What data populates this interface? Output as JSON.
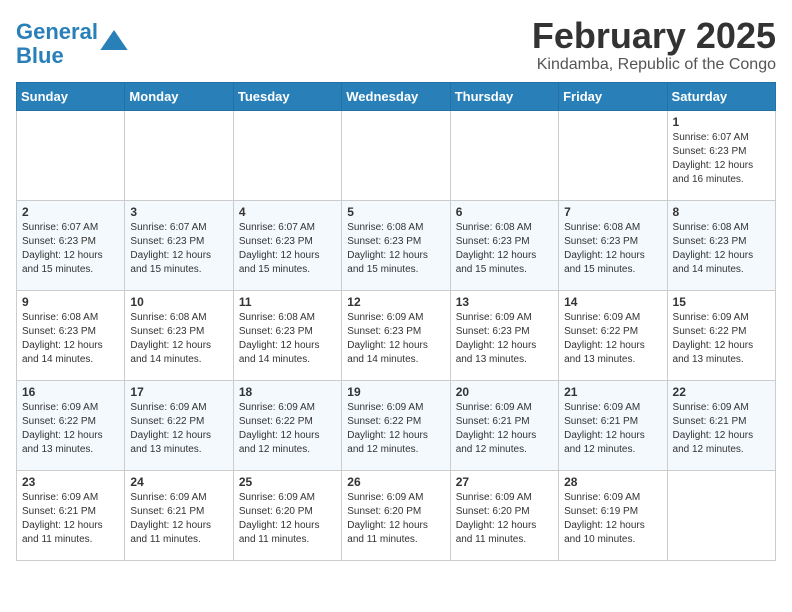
{
  "header": {
    "logo_line1": "General",
    "logo_line2": "Blue",
    "main_title": "February 2025",
    "subtitle": "Kindamba, Republic of the Congo"
  },
  "weekdays": [
    "Sunday",
    "Monday",
    "Tuesday",
    "Wednesday",
    "Thursday",
    "Friday",
    "Saturday"
  ],
  "weeks": [
    [
      {
        "day": "",
        "info": ""
      },
      {
        "day": "",
        "info": ""
      },
      {
        "day": "",
        "info": ""
      },
      {
        "day": "",
        "info": ""
      },
      {
        "day": "",
        "info": ""
      },
      {
        "day": "",
        "info": ""
      },
      {
        "day": "1",
        "info": "Sunrise: 6:07 AM\nSunset: 6:23 PM\nDaylight: 12 hours\nand 16 minutes."
      }
    ],
    [
      {
        "day": "2",
        "info": "Sunrise: 6:07 AM\nSunset: 6:23 PM\nDaylight: 12 hours\nand 15 minutes."
      },
      {
        "day": "3",
        "info": "Sunrise: 6:07 AM\nSunset: 6:23 PM\nDaylight: 12 hours\nand 15 minutes."
      },
      {
        "day": "4",
        "info": "Sunrise: 6:07 AM\nSunset: 6:23 PM\nDaylight: 12 hours\nand 15 minutes."
      },
      {
        "day": "5",
        "info": "Sunrise: 6:08 AM\nSunset: 6:23 PM\nDaylight: 12 hours\nand 15 minutes."
      },
      {
        "day": "6",
        "info": "Sunrise: 6:08 AM\nSunset: 6:23 PM\nDaylight: 12 hours\nand 15 minutes."
      },
      {
        "day": "7",
        "info": "Sunrise: 6:08 AM\nSunset: 6:23 PM\nDaylight: 12 hours\nand 15 minutes."
      },
      {
        "day": "8",
        "info": "Sunrise: 6:08 AM\nSunset: 6:23 PM\nDaylight: 12 hours\nand 14 minutes."
      }
    ],
    [
      {
        "day": "9",
        "info": "Sunrise: 6:08 AM\nSunset: 6:23 PM\nDaylight: 12 hours\nand 14 minutes."
      },
      {
        "day": "10",
        "info": "Sunrise: 6:08 AM\nSunset: 6:23 PM\nDaylight: 12 hours\nand 14 minutes."
      },
      {
        "day": "11",
        "info": "Sunrise: 6:08 AM\nSunset: 6:23 PM\nDaylight: 12 hours\nand 14 minutes."
      },
      {
        "day": "12",
        "info": "Sunrise: 6:09 AM\nSunset: 6:23 PM\nDaylight: 12 hours\nand 14 minutes."
      },
      {
        "day": "13",
        "info": "Sunrise: 6:09 AM\nSunset: 6:23 PM\nDaylight: 12 hours\nand 13 minutes."
      },
      {
        "day": "14",
        "info": "Sunrise: 6:09 AM\nSunset: 6:22 PM\nDaylight: 12 hours\nand 13 minutes."
      },
      {
        "day": "15",
        "info": "Sunrise: 6:09 AM\nSunset: 6:22 PM\nDaylight: 12 hours\nand 13 minutes."
      }
    ],
    [
      {
        "day": "16",
        "info": "Sunrise: 6:09 AM\nSunset: 6:22 PM\nDaylight: 12 hours\nand 13 minutes."
      },
      {
        "day": "17",
        "info": "Sunrise: 6:09 AM\nSunset: 6:22 PM\nDaylight: 12 hours\nand 13 minutes."
      },
      {
        "day": "18",
        "info": "Sunrise: 6:09 AM\nSunset: 6:22 PM\nDaylight: 12 hours\nand 12 minutes."
      },
      {
        "day": "19",
        "info": "Sunrise: 6:09 AM\nSunset: 6:22 PM\nDaylight: 12 hours\nand 12 minutes."
      },
      {
        "day": "20",
        "info": "Sunrise: 6:09 AM\nSunset: 6:21 PM\nDaylight: 12 hours\nand 12 minutes."
      },
      {
        "day": "21",
        "info": "Sunrise: 6:09 AM\nSunset: 6:21 PM\nDaylight: 12 hours\nand 12 minutes."
      },
      {
        "day": "22",
        "info": "Sunrise: 6:09 AM\nSunset: 6:21 PM\nDaylight: 12 hours\nand 12 minutes."
      }
    ],
    [
      {
        "day": "23",
        "info": "Sunrise: 6:09 AM\nSunset: 6:21 PM\nDaylight: 12 hours\nand 11 minutes."
      },
      {
        "day": "24",
        "info": "Sunrise: 6:09 AM\nSunset: 6:21 PM\nDaylight: 12 hours\nand 11 minutes."
      },
      {
        "day": "25",
        "info": "Sunrise: 6:09 AM\nSunset: 6:20 PM\nDaylight: 12 hours\nand 11 minutes."
      },
      {
        "day": "26",
        "info": "Sunrise: 6:09 AM\nSunset: 6:20 PM\nDaylight: 12 hours\nand 11 minutes."
      },
      {
        "day": "27",
        "info": "Sunrise: 6:09 AM\nSunset: 6:20 PM\nDaylight: 12 hours\nand 11 minutes."
      },
      {
        "day": "28",
        "info": "Sunrise: 6:09 AM\nSunset: 6:19 PM\nDaylight: 12 hours\nand 10 minutes."
      },
      {
        "day": "",
        "info": ""
      }
    ]
  ]
}
